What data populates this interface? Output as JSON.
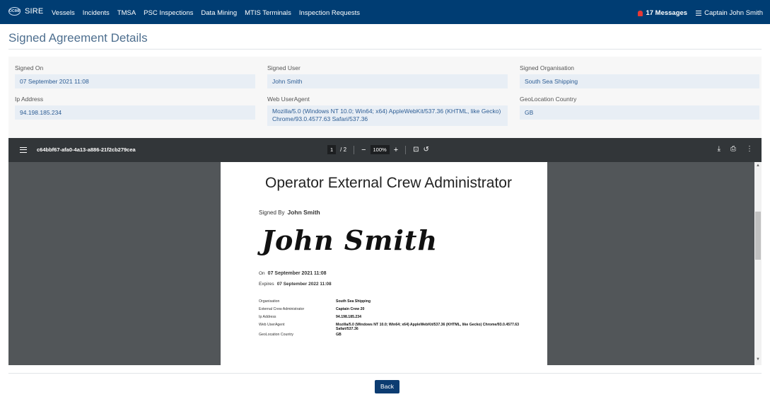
{
  "nav": {
    "brand": "SIRE",
    "logo_text": "OCIMF",
    "items": [
      "Vessels",
      "Incidents",
      "TMSA",
      "PSC Inspections",
      "Data Mining",
      "MTIS Terminals",
      "Inspection Requests"
    ],
    "messages": "17 Messages",
    "user": "Captain John Smith"
  },
  "page": {
    "title": "Signed Agreement Details"
  },
  "details": {
    "signed_on_label": "Signed On",
    "signed_on": "07 September 2021 11:08",
    "signed_user_label": "Signed User",
    "signed_user": "John Smith",
    "signed_org_label": "Signed Organisation",
    "signed_org": "South Sea Shipping",
    "ip_label": "Ip Address",
    "ip": "94.198.185.234",
    "ua_label": "Web UserAgent",
    "ua_line1": "Mozilla/5.0 (Windows NT 10.0; Win64; x64) AppleWebKit/537.36 (KHTML, like Gecko)",
    "ua_line2": "Chrome/93.0.4577.63 Safari/537.36",
    "geo_label": "GeoLocation Country",
    "geo": "GB"
  },
  "viewer": {
    "doc_name": "c64bbf67-afa0-4a13-a886-21f2cb279cea",
    "page_current": "1",
    "page_total": "/ 2",
    "zoom": "100%"
  },
  "document": {
    "title": "Operator External Crew Administrator",
    "signed_by_label": "Signed By",
    "signed_by": "John Smith",
    "signature": "John Smith",
    "on_label": "On",
    "on_value": "07 September 2021 11:08",
    "expires_label": "Expires",
    "expires_value": "07 September 2022 11:08",
    "rows": [
      {
        "k": "Organisation",
        "v": "South Sea Shipping"
      },
      {
        "k": "External Crew Administrator",
        "v": "Captain Crew 20"
      },
      {
        "k": "Ip Address",
        "v": "94.198.185.234"
      },
      {
        "k": "Web UserAgent",
        "v": "Mozilla/5.0 (Windows NT 10.0; Win64; x64) AppleWebKit/537.36 (KHTML, like Gecko) Chrome/93.0.4577.63 Safari/537.36"
      },
      {
        "k": "GeoLocation Country",
        "v": "GB"
      }
    ]
  },
  "actions": {
    "back": "Back"
  }
}
